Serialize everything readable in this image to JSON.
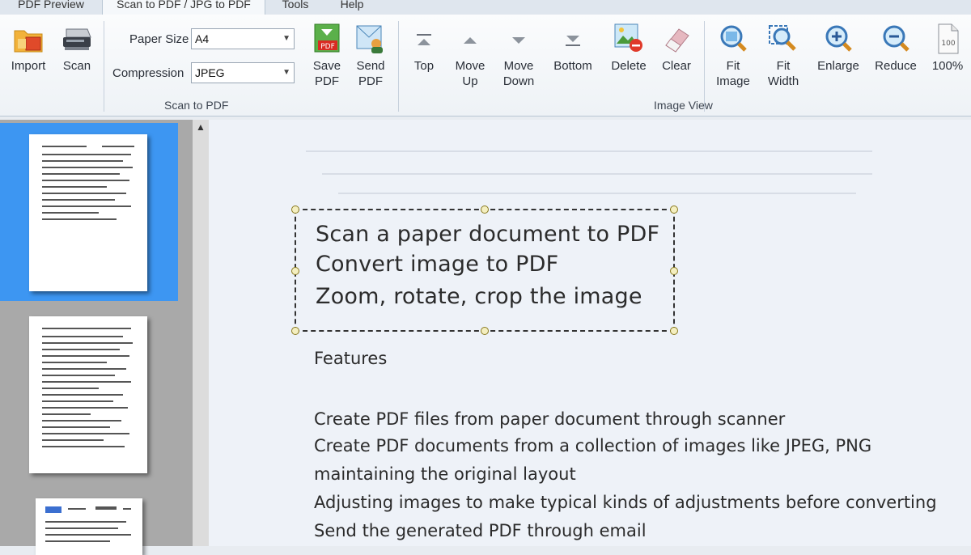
{
  "tabs": [
    "PDF Preview",
    "Scan to PDF / JPG to PDF",
    "Tools",
    "Help"
  ],
  "ribbon": {
    "import": "Import",
    "scan": "Scan",
    "paper_size_label": "Paper Size",
    "paper_size_value": "A4",
    "compression_label": "Compression",
    "compression_value": "JPEG",
    "save_pdf": [
      "Save",
      "PDF"
    ],
    "send_pdf": [
      "Send",
      "PDF"
    ],
    "group_scan": "Scan to PDF",
    "top": "Top",
    "move_up": [
      "Move",
      "Up"
    ],
    "move_down": [
      "Move",
      "Down"
    ],
    "bottom": "Bottom",
    "delete": "Delete",
    "clear": "Clear",
    "fit_image": [
      "Fit",
      "Image"
    ],
    "fit_width": [
      "Fit",
      "Width"
    ],
    "enlarge": "Enlarge",
    "reduce": "Reduce",
    "zoom100": "100%",
    "group_view": "Image View",
    "pdf_badge": "PDF"
  },
  "document": {
    "selected_lines": [
      "Scan a paper document to PDF",
      "Convert image to PDF",
      "Zoom, rotate, crop the image"
    ],
    "features_heading": "Features",
    "feature_lines": [
      "Create PDF files from paper document through scanner",
      "Create  PDF  documents  from  a  collection  of  images  like  JPEG,  PNG",
      "maintaining the original layout",
      "Adjusting images to make typical kinds of adjustments before converting",
      "Send the generated PDF through email"
    ]
  },
  "colors": {
    "selection_blue": "#3d96f2",
    "thumb_panel": "#a9a9a9",
    "ribbon_bg": "#f5f8fb"
  }
}
